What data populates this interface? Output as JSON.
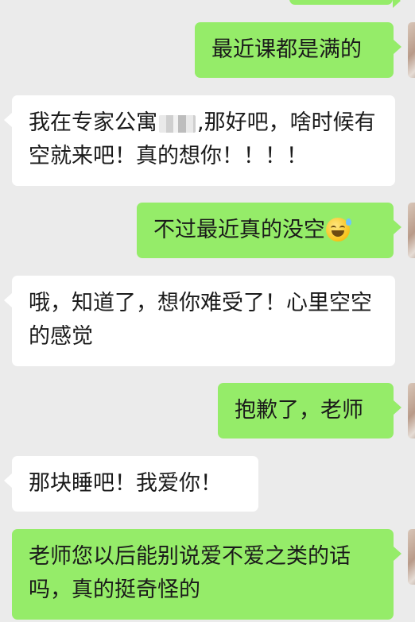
{
  "messages": [
    {
      "id": "m0",
      "side": "sent",
      "text": ""
    },
    {
      "id": "m1",
      "side": "sent",
      "text": "最近课都是满的"
    },
    {
      "id": "m2",
      "side": "received",
      "text_before": "我在专家公寓",
      "text_after": ",那好吧，啥时候有空就来吧！真的想你！！！！"
    },
    {
      "id": "m3",
      "side": "sent",
      "text": "不过最近真的没空",
      "emoji": "sweat-smile-emoji"
    },
    {
      "id": "m4",
      "side": "received",
      "text": "哦，知道了，想你难受了！心里空空的感觉"
    },
    {
      "id": "m5",
      "side": "sent",
      "text": "抱歉了，老师"
    },
    {
      "id": "m6",
      "side": "received",
      "text": "那块睡吧！我爱你！"
    },
    {
      "id": "m7",
      "side": "sent",
      "text": "老师您以后能别说爱不爱之类的话吗，真的挺奇怪的"
    }
  ],
  "colors": {
    "sent_bubble": "#95ec69",
    "received_bubble": "#ffffff",
    "background": "#ebebeb"
  },
  "icons": [
    "avatar",
    "sweat-smile-emoji",
    "redaction-blur"
  ]
}
